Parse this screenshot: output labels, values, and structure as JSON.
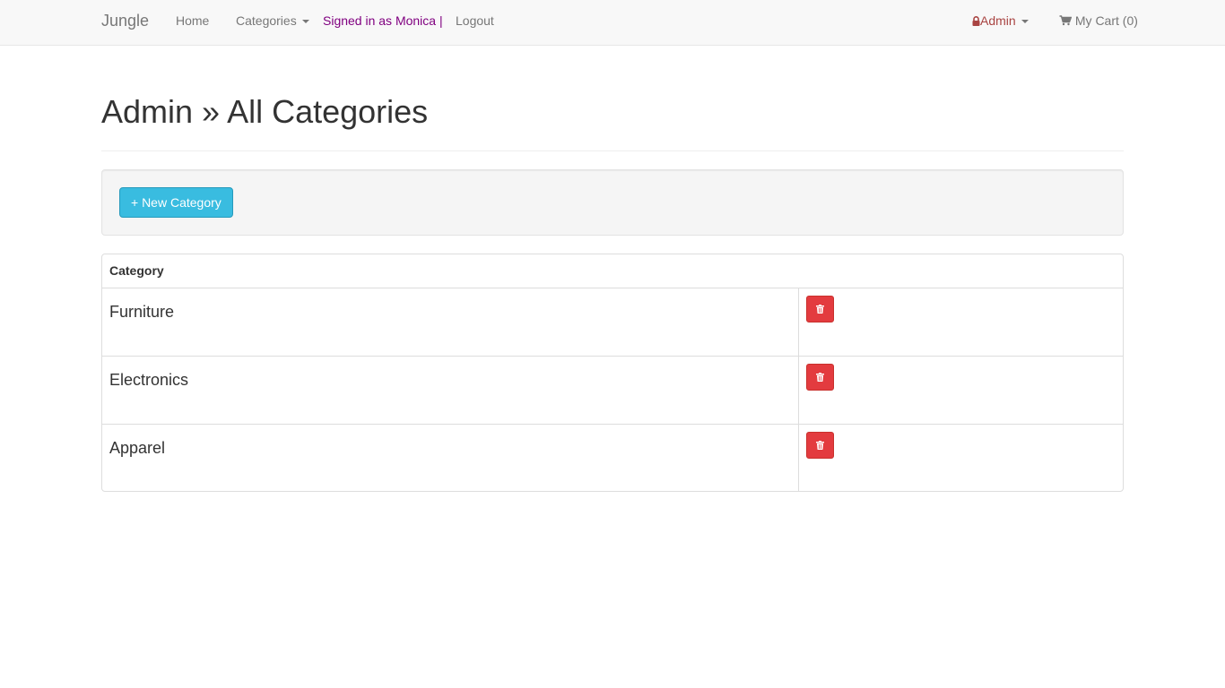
{
  "navbar": {
    "brand": "Jungle",
    "home": "Home",
    "categories": "Categories",
    "signed_in": "Signed in as Monica |",
    "logout": "Logout",
    "admin": "Admin",
    "cart": "My Cart (0)"
  },
  "page": {
    "title": "Admin » All Categories",
    "new_category_button": "+ New Category"
  },
  "table": {
    "header": "Category",
    "rows": [
      {
        "name": "Furniture"
      },
      {
        "name": "Electronics"
      },
      {
        "name": "Apparel"
      }
    ]
  },
  "icons": {
    "lock": "lock-icon",
    "cart": "shopping-cart-icon",
    "delete": "trash-icon"
  },
  "colors": {
    "navbar_bg": "#f8f8f8",
    "signed_in_text": "#800080",
    "admin_text": "#a94442",
    "info_button": "#39bce0",
    "danger_button": "#e33b3f"
  }
}
